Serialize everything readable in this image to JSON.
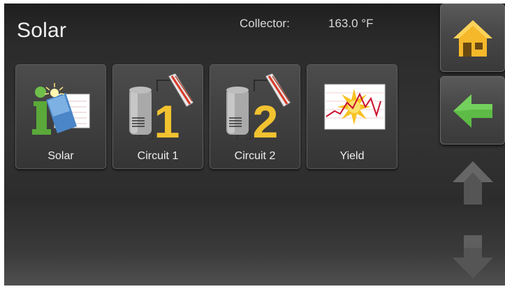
{
  "header": {
    "title": "Solar",
    "collector_label": "Collector:",
    "collector_value": "163.0 °F"
  },
  "tiles": [
    {
      "label": "Solar",
      "icon": "solar-info-icon"
    },
    {
      "label": "Circuit 1",
      "icon": "storage-tank-circuit-1-icon"
    },
    {
      "label": "Circuit 2",
      "icon": "storage-tank-circuit-2-icon"
    },
    {
      "label": "Yield",
      "icon": "yield-chart-icon"
    }
  ],
  "side_nav": [
    {
      "icon": "home-icon",
      "color": "#f5b82a"
    },
    {
      "icon": "back-arrow-icon",
      "color": "#5dbb46"
    },
    {
      "icon": "up-arrow-icon",
      "color": "#555555"
    },
    {
      "icon": "down-arrow-icon",
      "color": "#555555"
    }
  ],
  "colors": {
    "accent_yellow": "#f2c230",
    "accent_green": "#5dbb46",
    "curve_red": "#d0203a"
  }
}
